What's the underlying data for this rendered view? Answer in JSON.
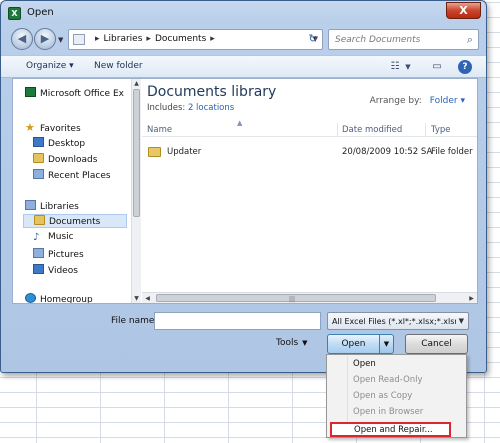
{
  "window": {
    "title": "Open",
    "close_label": "X"
  },
  "address": {
    "segments": [
      "Libraries",
      "Documents"
    ],
    "search_placeholder": "Search Documents"
  },
  "toolbar": {
    "organize": "Organize ▾",
    "new_folder": "New folder"
  },
  "nav": {
    "top_item": "Microsoft Office Ex",
    "favorites_header": "Favorites",
    "favorites": [
      "Desktop",
      "Downloads",
      "Recent Places"
    ],
    "libraries_header": "Libraries",
    "libraries": [
      "Documents",
      "Music",
      "Pictures",
      "Videos"
    ],
    "homegroup": "Homegroup"
  },
  "library": {
    "title": "Documents library",
    "includes_label": "Includes:",
    "includes_link": "2 locations",
    "arrange_label": "Arrange by:",
    "arrange_value": "Folder ▾"
  },
  "columns": [
    "Name",
    "Date modified",
    "Type"
  ],
  "files": [
    {
      "name": "Updater",
      "date": "20/08/2009 10:52 SA",
      "type": "File folder"
    }
  ],
  "bottom": {
    "file_name_label": "File name:",
    "file_name_value": "",
    "file_type": "All Excel Files (*.xl*;*.xlsx;*.xlsm;",
    "tools": "Tools",
    "open": "Open",
    "cancel": "Cancel"
  },
  "open_menu": {
    "items": [
      {
        "label": "Open",
        "enabled": true
      },
      {
        "label": "Open Read-Only",
        "enabled": false
      },
      {
        "label": "Open as Copy",
        "enabled": false
      },
      {
        "label": "Open in Browser",
        "enabled": false
      },
      {
        "label": "Open and Repair...",
        "enabled": true,
        "highlighted": true
      }
    ]
  },
  "colors": {
    "highlight_border": "#d8272e",
    "link": "#2b63b3",
    "title_blue": "#1e395b"
  }
}
